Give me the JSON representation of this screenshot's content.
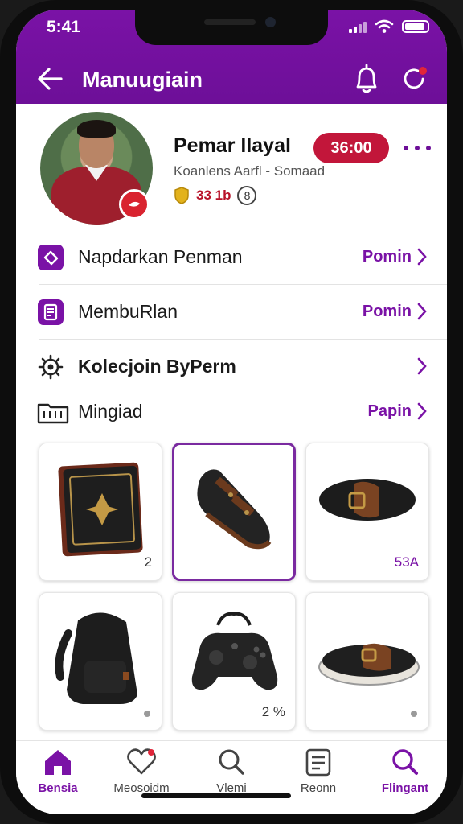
{
  "status": {
    "time": "5:41"
  },
  "header": {
    "title": "Manuugiain"
  },
  "profile": {
    "name": "Pemar llayal",
    "subtitle": "Koanlens Aarfl - Somaad",
    "rating": "33 1b",
    "count": "8",
    "price": "36:00"
  },
  "menu": [
    {
      "label": "Napdarkan Penman",
      "link": "Pomin"
    },
    {
      "label": "MembuRlan",
      "link": "Pomin"
    },
    {
      "label": "Kolecjoin ByPerm",
      "link": ""
    },
    {
      "label": "Mingiad",
      "link": "Papin"
    }
  ],
  "grid": [
    {
      "item": "bag",
      "label": "2"
    },
    {
      "item": "boot",
      "label": ""
    },
    {
      "item": "slide",
      "label": "53A"
    },
    {
      "item": "backpack",
      "label": ""
    },
    {
      "item": "controller",
      "label": "2 %"
    },
    {
      "item": "sandal",
      "label": ""
    }
  ],
  "nav": [
    {
      "label": "Bensia",
      "icon": "home-icon"
    },
    {
      "label": "Meosoidm",
      "icon": "heart-icon"
    },
    {
      "label": "Vlemi",
      "icon": "search-icon"
    },
    {
      "label": "Reonn",
      "icon": "calendar-icon"
    },
    {
      "label": "Flingant",
      "icon": "search-active-icon"
    }
  ],
  "colors": {
    "brand": "#7a12a6",
    "price": "#c2163a",
    "badge": "#d9232f"
  }
}
